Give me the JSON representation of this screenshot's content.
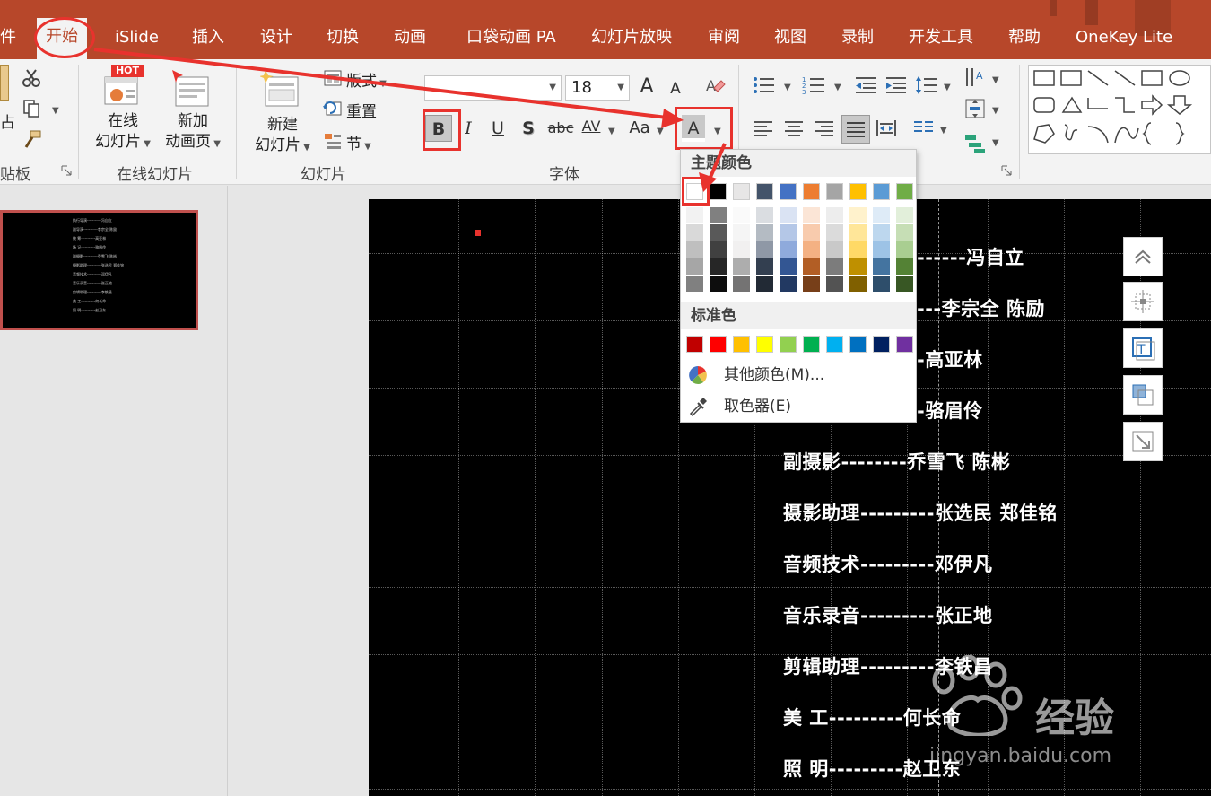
{
  "tabs": {
    "file_partial": "件",
    "home": "开始",
    "islide": "iSlide",
    "insert": "插入",
    "design": "设计",
    "transitions": "切换",
    "animations": "动画",
    "pocket_animation": "口袋动画 PA",
    "slideshow": "幻灯片放映",
    "review": "审阅",
    "view": "视图",
    "record": "录制",
    "developer": "开发工具",
    "help": "帮助",
    "onekey": "OneKey Lite"
  },
  "ribbon": {
    "clipboard_label": "贴板",
    "paste_partial": "占",
    "online_slides_line1": "在线",
    "online_slides_line2": "幻灯片",
    "hot_badge": "HOT",
    "new_anim_line1": "新加",
    "new_anim_line2": "动画页",
    "online_group_label": "在线幻灯片",
    "new_slide_line1": "新建",
    "new_slide_line2": "幻灯片",
    "layout": "版式",
    "reset": "重置",
    "section": "节",
    "slides_group_label": "幻灯片",
    "font_name": "",
    "font_size": "18",
    "bold": "B",
    "italic": "I",
    "underline": "U",
    "shadow": "S",
    "strike": "abc",
    "spacing": "AV",
    "case": "Aa",
    "font_color": "A",
    "grow": "A",
    "shrink": "A",
    "font_group_label": "字体"
  },
  "color_panel": {
    "theme_header": "主题颜色",
    "standard_header": "标准色",
    "more_colors": "其他颜色(M)...",
    "eyedropper": "取色器(E)",
    "theme_colors": [
      "#ffffff",
      "#000000",
      "#e7e6e6",
      "#44546a",
      "#4472c4",
      "#ed7d31",
      "#a5a5a5",
      "#ffc000",
      "#5b9bd5",
      "#70ad47"
    ],
    "standard_colors": [
      "#c00000",
      "#ff0000",
      "#ffc000",
      "#ffff00",
      "#92d050",
      "#00b050",
      "#00b0f0",
      "#0070c0",
      "#002060",
      "#7030a0"
    ]
  },
  "slide": {
    "credits": [
      "------冯自立",
      "---李宗全 陈励",
      "-高亚林",
      "-骆眉伶",
      "副摄影--------乔雪飞 陈彬",
      "摄影助理---------张选民 郑佳铭",
      "音频技术---------邓伊凡",
      "音乐录音---------张正地",
      "剪辑助理---------李铁昌",
      "美 工---------何长命",
      "照 明---------赵卫东"
    ]
  },
  "thumbnail": {
    "lines": [
      "执行导演-----------冯自立",
      "副导演-----------李宗全 陈励",
      "统 筹-----------高亚林",
      "场 记-----------骆眉伶",
      "副摄影-----------乔雪飞 陈彬",
      "摄影助理-----------张选民 郑佳铭",
      "音频技术-----------邓伊凡",
      "音乐录音-----------张正地",
      "剪辑助理-----------李铁昌",
      "美 工-----------何长命",
      "照 明-----------赵卫东"
    ]
  },
  "watermark": {
    "brand": "经验",
    "url": "jingyan.baidu.com"
  }
}
